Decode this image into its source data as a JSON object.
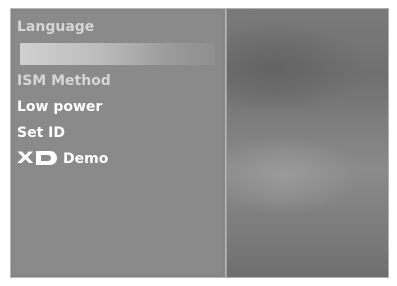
{
  "menu": {
    "items": [
      {
        "label": "Language"
      },
      {
        "label": ""
      },
      {
        "label": "ISM Method"
      },
      {
        "label": "Low power"
      },
      {
        "label": "Set ID"
      },
      {
        "label": "Demo",
        "logo": "xd-logo"
      }
    ],
    "colors": {
      "panel": "#8a8a8a",
      "text": "#ffffff",
      "highlight": "#c4c4c4"
    }
  }
}
